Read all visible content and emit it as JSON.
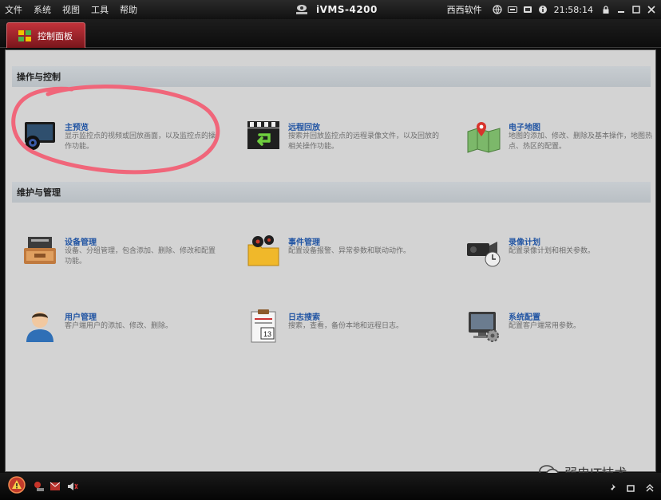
{
  "menubar": {
    "items": [
      "文件",
      "系统",
      "视图",
      "工具",
      "帮助"
    ],
    "app_title": "iVMS-4200",
    "user": "西西软件",
    "time": "21:58:14"
  },
  "tabs": [
    {
      "label": "控制面板",
      "active": true
    }
  ],
  "sections": [
    {
      "title": "操作与控制",
      "items": [
        {
          "title": "主预览",
          "desc": "显示监控点的视频或回放画面，以及监控点的操作功能。",
          "icon": "monitor-icon"
        },
        {
          "title": "远程回放",
          "desc": "搜索并回放监控点的远程录像文件，以及回放的相关操作功能。",
          "icon": "playback-icon"
        },
        {
          "title": "电子地图",
          "desc": "地图的添加、修改、删除及基本操作，地图热点、热区的配置。",
          "icon": "map-icon"
        }
      ]
    },
    {
      "title": "维护与管理",
      "items": [
        {
          "title": "设备管理",
          "desc": "设备、分组管理，包含添加、删除、修改和配置功能。",
          "icon": "device-icon"
        },
        {
          "title": "事件管理",
          "desc": "配置设备报警、异常参数和联动动作。",
          "icon": "event-icon"
        },
        {
          "title": "录像计划",
          "desc": "配置录像计划和相关参数。",
          "icon": "camera-icon"
        },
        {
          "title": "用户管理",
          "desc": "客户端用户的添加、修改、删除。",
          "icon": "user-icon"
        },
        {
          "title": "日志搜索",
          "desc": "搜索，查看，备份本地和远程日志。",
          "icon": "log-icon"
        },
        {
          "title": "系统配置",
          "desc": "配置客户端常用参数。",
          "icon": "config-icon"
        }
      ]
    }
  ],
  "log_icon_day": "13",
  "watermark": "弱电IT技术",
  "colors": {
    "accent_red": "#b8262e",
    "link_blue": "#2255a3",
    "panel_bg": "#d3d3d3"
  }
}
